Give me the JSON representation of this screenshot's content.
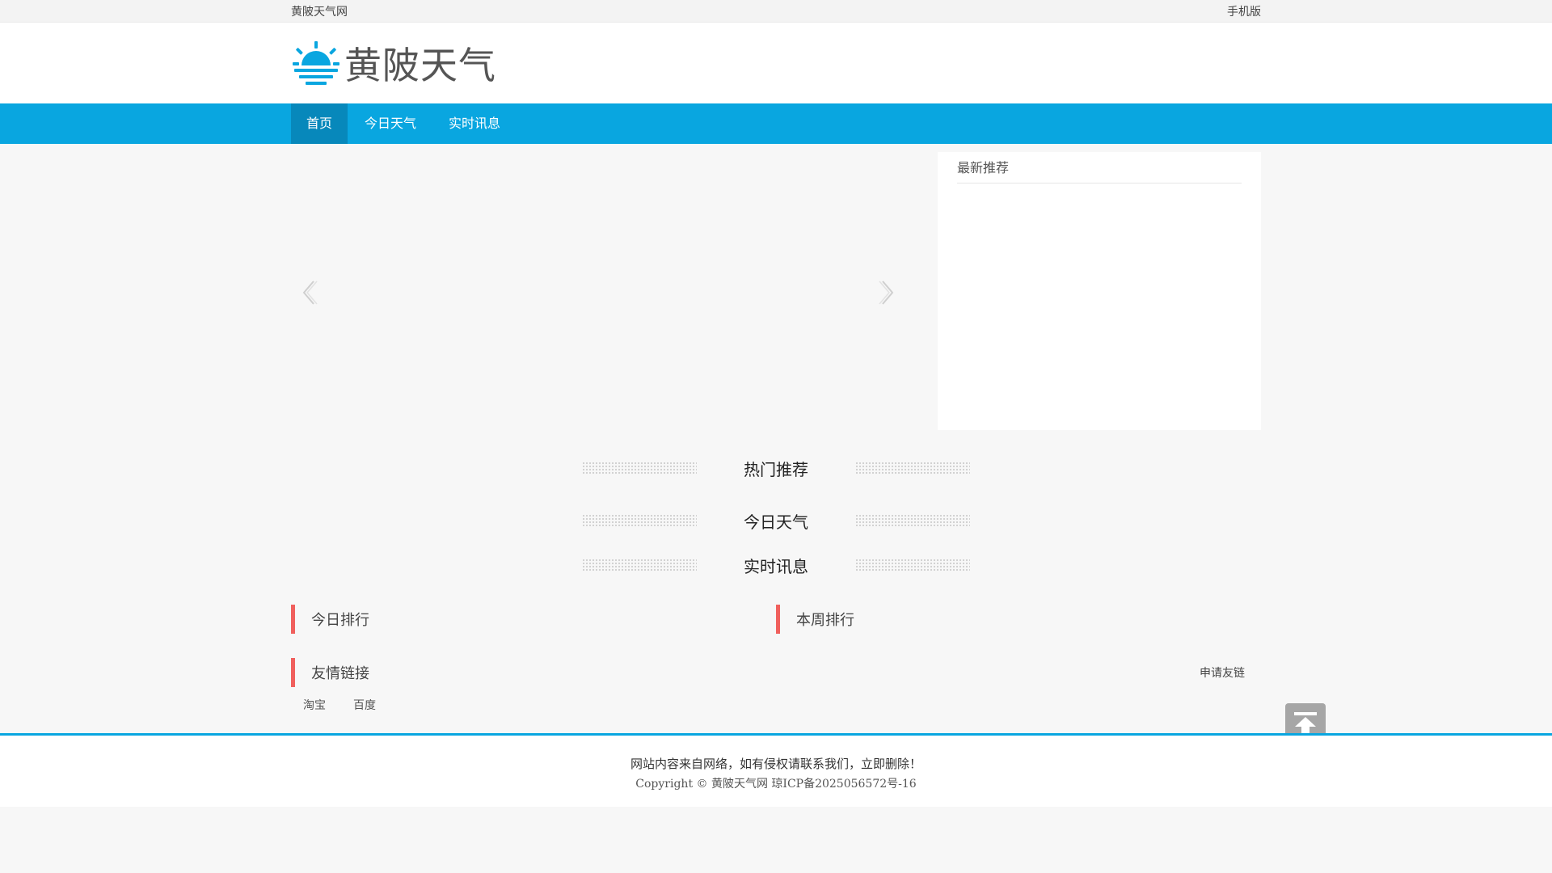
{
  "topbar": {
    "site_name": "黄陂天气网",
    "mobile_link": "手机版"
  },
  "logo": {
    "text": "黄陂天气",
    "icon": "sunrise-icon",
    "color": "#09a6e0"
  },
  "nav": {
    "items": [
      {
        "label": "首页"
      },
      {
        "label": "今日天气"
      },
      {
        "label": "实时讯息"
      }
    ],
    "active_index": 0,
    "color": "#09a6e0"
  },
  "slider": {
    "prev_icon": "chevron-left-icon",
    "next_icon": "chevron-right-icon"
  },
  "recommend": {
    "title": "最新推荐"
  },
  "sections": [
    {
      "title": "热门推荐"
    },
    {
      "title": "今日天气"
    },
    {
      "title": "实时讯息"
    }
  ],
  "ranks": {
    "today": "今日排行",
    "week": "本周排行",
    "accent": "#f0605d"
  },
  "friend_links": {
    "title": "友情链接",
    "apply": "申请友链",
    "items": [
      {
        "label": "淘宝"
      },
      {
        "label": "百度"
      }
    ]
  },
  "footer": {
    "notice": "网站内容来自网络，如有侵权请联系我们，立即删除！",
    "copyright": "Copyright © 黄陂天气网 琼ICP备2025056572号-16"
  },
  "back_to_top": {
    "icon": "back-to-top-icon"
  }
}
